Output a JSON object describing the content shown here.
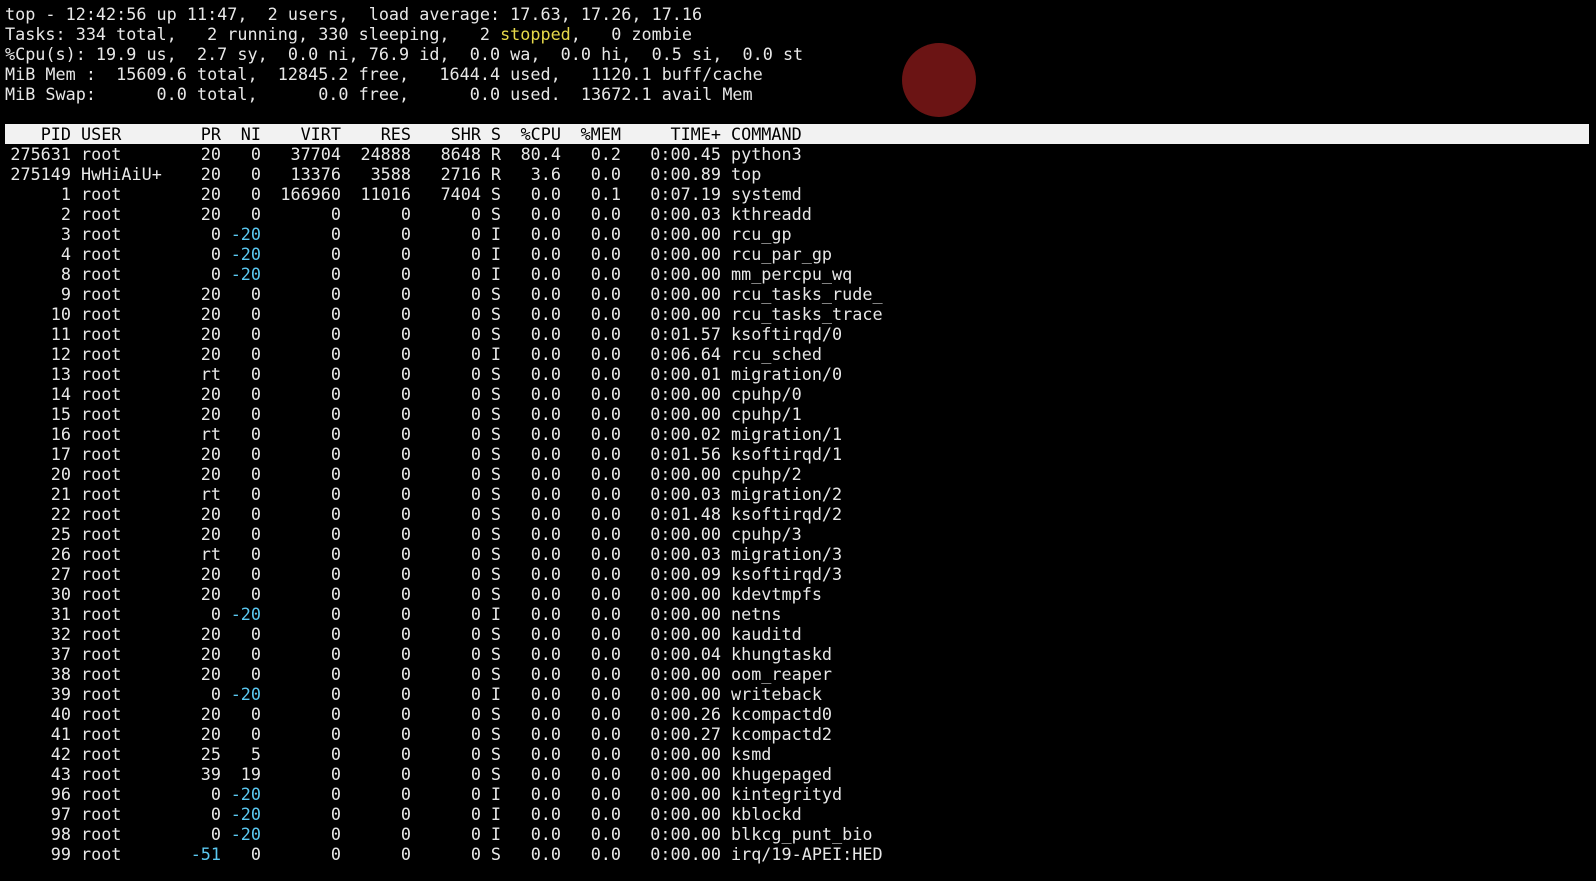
{
  "summary": {
    "line1": "top - 12:42:56 up 11:47,  2 users,  load average: 17.63, 17.26, 17.16",
    "tasks_prefix": "Tasks: 334 total,   2 running, 330 sleeping,   2 ",
    "tasks_stopped": "stopped",
    "tasks_suffix": ",   0 zombie",
    "cpu": "%Cpu(s): 19.9 us,  2.7 sy,  0.0 ni, 76.9 id,  0.0 wa,  0.0 hi,  0.5 si,  0.0 st",
    "mem": "MiB Mem :  15609.6 total,  12845.2 free,   1644.4 used,   1120.1 buff/cache",
    "swap": "MiB Swap:      0.0 total,      0.0 free,      0.0 used.  13672.1 avail Mem"
  },
  "columns": {
    "pid": "PID",
    "user": "USER",
    "pr": "PR",
    "ni": "NI",
    "virt": "VIRT",
    "res": "RES",
    "shr": "SHR",
    "s": "S",
    "cpu": "%CPU",
    "mem": "%MEM",
    "time": "TIME+",
    "command": "COMMAND"
  },
  "processes": [
    [
      "275631",
      "root",
      "20",
      "0",
      "37704",
      "24888",
      "8648",
      "R",
      "80.4",
      "0.2",
      "0:00.45",
      "python3"
    ],
    [
      "275149",
      "HwHiAiU+",
      "20",
      "0",
      "13376",
      "3588",
      "2716",
      "R",
      "3.6",
      "0.0",
      "0:00.89",
      "top"
    ],
    [
      "1",
      "root",
      "20",
      "0",
      "166960",
      "11016",
      "7404",
      "S",
      "0.0",
      "0.1",
      "0:07.19",
      "systemd"
    ],
    [
      "2",
      "root",
      "20",
      "0",
      "0",
      "0",
      "0",
      "S",
      "0.0",
      "0.0",
      "0:00.03",
      "kthreadd"
    ],
    [
      "3",
      "root",
      "0",
      "-20",
      "0",
      "0",
      "0",
      "I",
      "0.0",
      "0.0",
      "0:00.00",
      "rcu_gp"
    ],
    [
      "4",
      "root",
      "0",
      "-20",
      "0",
      "0",
      "0",
      "I",
      "0.0",
      "0.0",
      "0:00.00",
      "rcu_par_gp"
    ],
    [
      "8",
      "root",
      "0",
      "-20",
      "0",
      "0",
      "0",
      "I",
      "0.0",
      "0.0",
      "0:00.00",
      "mm_percpu_wq"
    ],
    [
      "9",
      "root",
      "20",
      "0",
      "0",
      "0",
      "0",
      "S",
      "0.0",
      "0.0",
      "0:00.00",
      "rcu_tasks_rude_"
    ],
    [
      "10",
      "root",
      "20",
      "0",
      "0",
      "0",
      "0",
      "S",
      "0.0",
      "0.0",
      "0:00.00",
      "rcu_tasks_trace"
    ],
    [
      "11",
      "root",
      "20",
      "0",
      "0",
      "0",
      "0",
      "S",
      "0.0",
      "0.0",
      "0:01.57",
      "ksoftirqd/0"
    ],
    [
      "12",
      "root",
      "20",
      "0",
      "0",
      "0",
      "0",
      "I",
      "0.0",
      "0.0",
      "0:06.64",
      "rcu_sched"
    ],
    [
      "13",
      "root",
      "rt",
      "0",
      "0",
      "0",
      "0",
      "S",
      "0.0",
      "0.0",
      "0:00.01",
      "migration/0"
    ],
    [
      "14",
      "root",
      "20",
      "0",
      "0",
      "0",
      "0",
      "S",
      "0.0",
      "0.0",
      "0:00.00",
      "cpuhp/0"
    ],
    [
      "15",
      "root",
      "20",
      "0",
      "0",
      "0",
      "0",
      "S",
      "0.0",
      "0.0",
      "0:00.00",
      "cpuhp/1"
    ],
    [
      "16",
      "root",
      "rt",
      "0",
      "0",
      "0",
      "0",
      "S",
      "0.0",
      "0.0",
      "0:00.02",
      "migration/1"
    ],
    [
      "17",
      "root",
      "20",
      "0",
      "0",
      "0",
      "0",
      "S",
      "0.0",
      "0.0",
      "0:01.56",
      "ksoftirqd/1"
    ],
    [
      "20",
      "root",
      "20",
      "0",
      "0",
      "0",
      "0",
      "S",
      "0.0",
      "0.0",
      "0:00.00",
      "cpuhp/2"
    ],
    [
      "21",
      "root",
      "rt",
      "0",
      "0",
      "0",
      "0",
      "S",
      "0.0",
      "0.0",
      "0:00.03",
      "migration/2"
    ],
    [
      "22",
      "root",
      "20",
      "0",
      "0",
      "0",
      "0",
      "S",
      "0.0",
      "0.0",
      "0:01.48",
      "ksoftirqd/2"
    ],
    [
      "25",
      "root",
      "20",
      "0",
      "0",
      "0",
      "0",
      "S",
      "0.0",
      "0.0",
      "0:00.00",
      "cpuhp/3"
    ],
    [
      "26",
      "root",
      "rt",
      "0",
      "0",
      "0",
      "0",
      "S",
      "0.0",
      "0.0",
      "0:00.03",
      "migration/3"
    ],
    [
      "27",
      "root",
      "20",
      "0",
      "0",
      "0",
      "0",
      "S",
      "0.0",
      "0.0",
      "0:00.09",
      "ksoftirqd/3"
    ],
    [
      "30",
      "root",
      "20",
      "0",
      "0",
      "0",
      "0",
      "S",
      "0.0",
      "0.0",
      "0:00.00",
      "kdevtmpfs"
    ],
    [
      "31",
      "root",
      "0",
      "-20",
      "0",
      "0",
      "0",
      "I",
      "0.0",
      "0.0",
      "0:00.00",
      "netns"
    ],
    [
      "32",
      "root",
      "20",
      "0",
      "0",
      "0",
      "0",
      "S",
      "0.0",
      "0.0",
      "0:00.00",
      "kauditd"
    ],
    [
      "37",
      "root",
      "20",
      "0",
      "0",
      "0",
      "0",
      "S",
      "0.0",
      "0.0",
      "0:00.04",
      "khungtaskd"
    ],
    [
      "38",
      "root",
      "20",
      "0",
      "0",
      "0",
      "0",
      "S",
      "0.0",
      "0.0",
      "0:00.00",
      "oom_reaper"
    ],
    [
      "39",
      "root",
      "0",
      "-20",
      "0",
      "0",
      "0",
      "I",
      "0.0",
      "0.0",
      "0:00.00",
      "writeback"
    ],
    [
      "40",
      "root",
      "20",
      "0",
      "0",
      "0",
      "0",
      "S",
      "0.0",
      "0.0",
      "0:00.26",
      "kcompactd0"
    ],
    [
      "41",
      "root",
      "20",
      "0",
      "0",
      "0",
      "0",
      "S",
      "0.0",
      "0.0",
      "0:00.27",
      "kcompactd2"
    ],
    [
      "42",
      "root",
      "25",
      "5",
      "0",
      "0",
      "0",
      "S",
      "0.0",
      "0.0",
      "0:00.00",
      "ksmd"
    ],
    [
      "43",
      "root",
      "39",
      "19",
      "0",
      "0",
      "0",
      "S",
      "0.0",
      "0.0",
      "0:00.00",
      "khugepaged"
    ],
    [
      "96",
      "root",
      "0",
      "-20",
      "0",
      "0",
      "0",
      "I",
      "0.0",
      "0.0",
      "0:00.00",
      "kintegrityd"
    ],
    [
      "97",
      "root",
      "0",
      "-20",
      "0",
      "0",
      "0",
      "I",
      "0.0",
      "0.0",
      "0:00.00",
      "kblockd"
    ],
    [
      "98",
      "root",
      "0",
      "-20",
      "0",
      "0",
      "0",
      "I",
      "0.0",
      "0.0",
      "0:00.00",
      "blkcg_punt_bio"
    ],
    [
      "99",
      "root",
      "-51",
      "0",
      "0",
      "0",
      "0",
      "S",
      "0.0",
      "0.0",
      "0:00.00",
      "irq/19-APEI:HED"
    ]
  ],
  "colors": {
    "background": "#000000",
    "foreground": "#e8e8e8",
    "header_bg": "#f2f2f2",
    "stopped": "#e6d84a",
    "negative_priority": "#5bc8f0",
    "cursor_circle": "#6b1414"
  }
}
